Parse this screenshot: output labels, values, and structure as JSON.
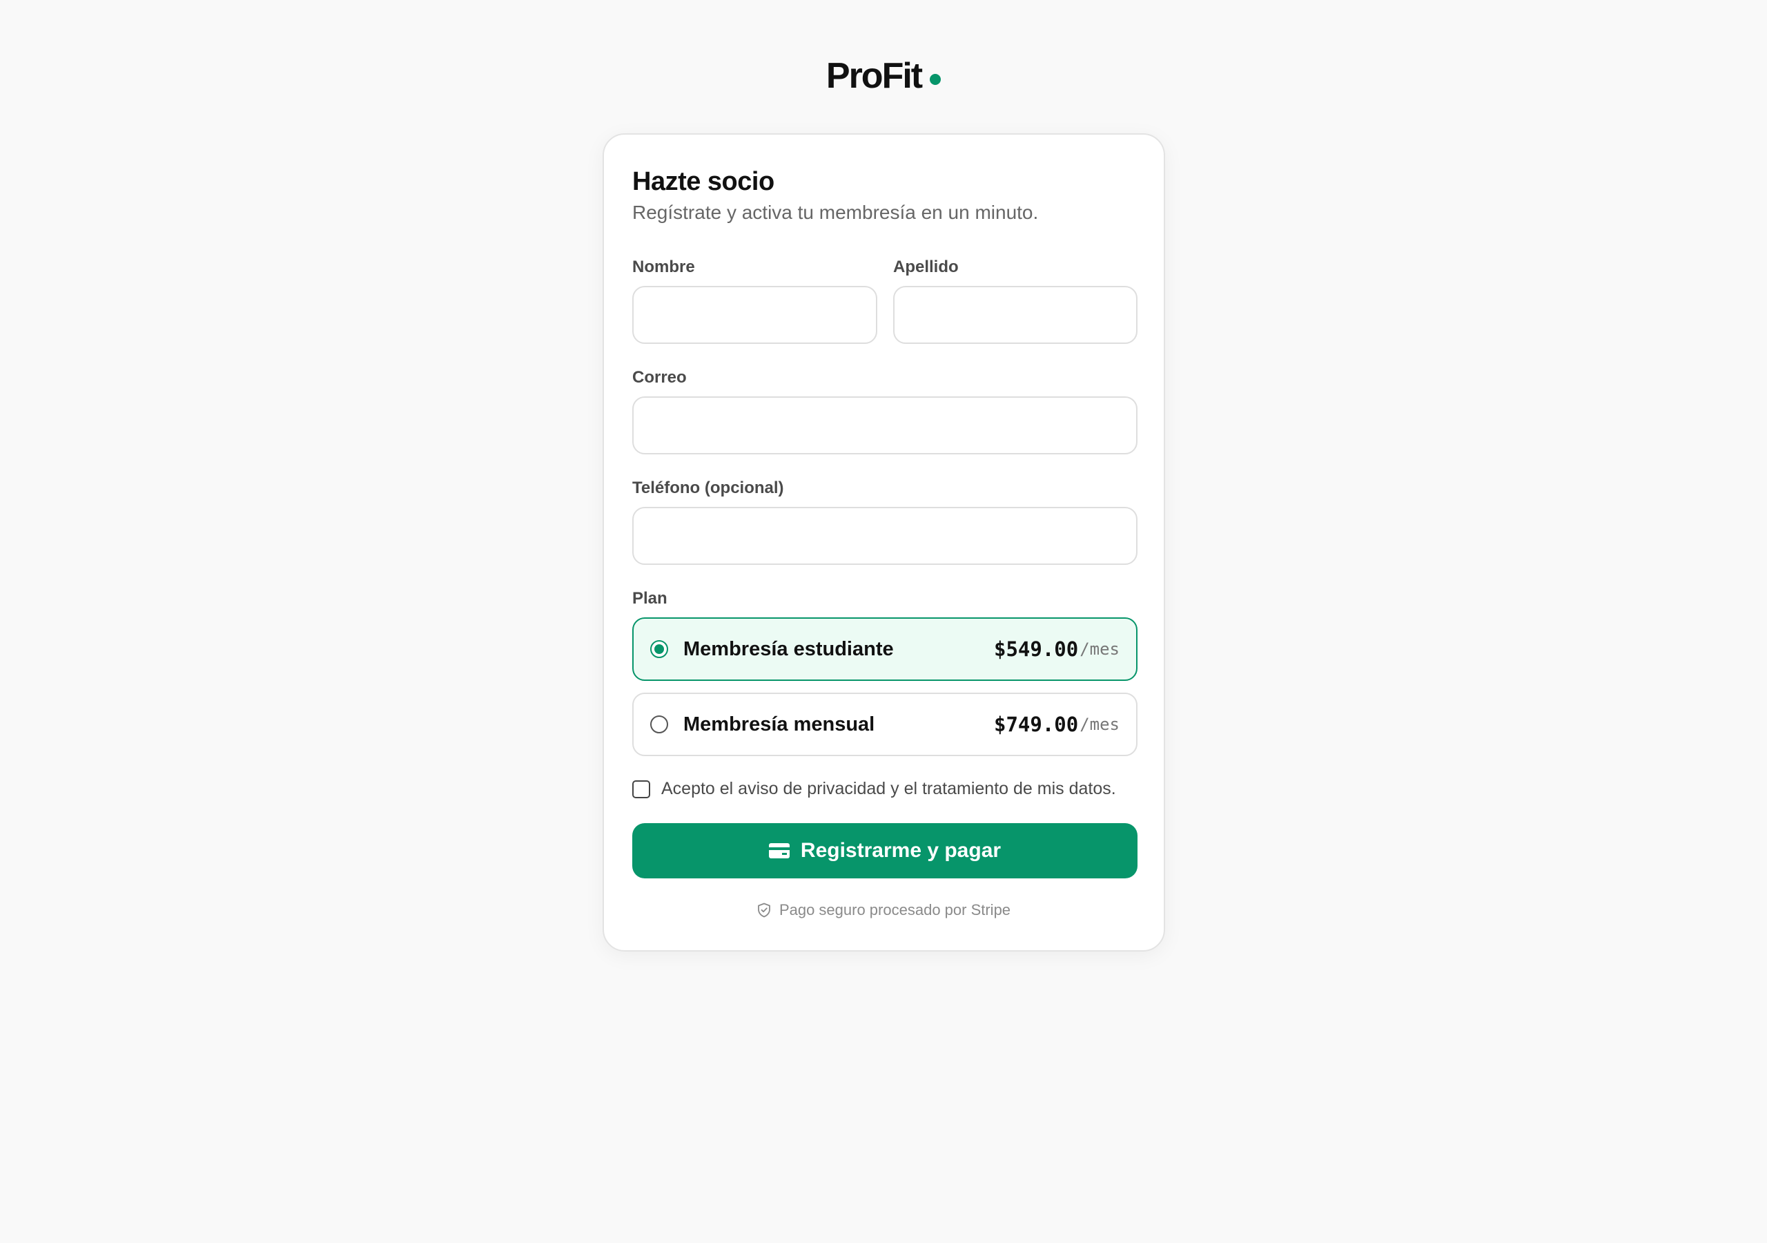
{
  "brand": {
    "name": "ProFit",
    "accent_color": "#07956a"
  },
  "form": {
    "title": "Hazte socio",
    "subtitle": "Regístrate y activa tu membresía en un minuto.",
    "fields": {
      "first_name": {
        "label": "Nombre",
        "value": "",
        "placeholder": ""
      },
      "last_name": {
        "label": "Apellido",
        "value": "",
        "placeholder": ""
      },
      "email": {
        "label": "Correo",
        "value": "",
        "placeholder": ""
      },
      "phone": {
        "label": "Teléfono (opcional)",
        "value": "",
        "placeholder": ""
      }
    },
    "plan_label": "Plan",
    "plans": [
      {
        "name": "Membresía estudiante",
        "price": "$549.00",
        "period": "/mes",
        "selected": true
      },
      {
        "name": "Membresía mensual",
        "price": "$749.00",
        "period": "/mes",
        "selected": false
      }
    ],
    "consent": {
      "text": "Acepto el aviso de privacidad y el tratamiento de mis datos.",
      "checked": false
    },
    "submit_label": "Registrarme y pagar",
    "submit_icon": "credit-card-icon",
    "secure_note": "Pago seguro procesado por Stripe",
    "secure_icon": "shield-check-icon"
  }
}
